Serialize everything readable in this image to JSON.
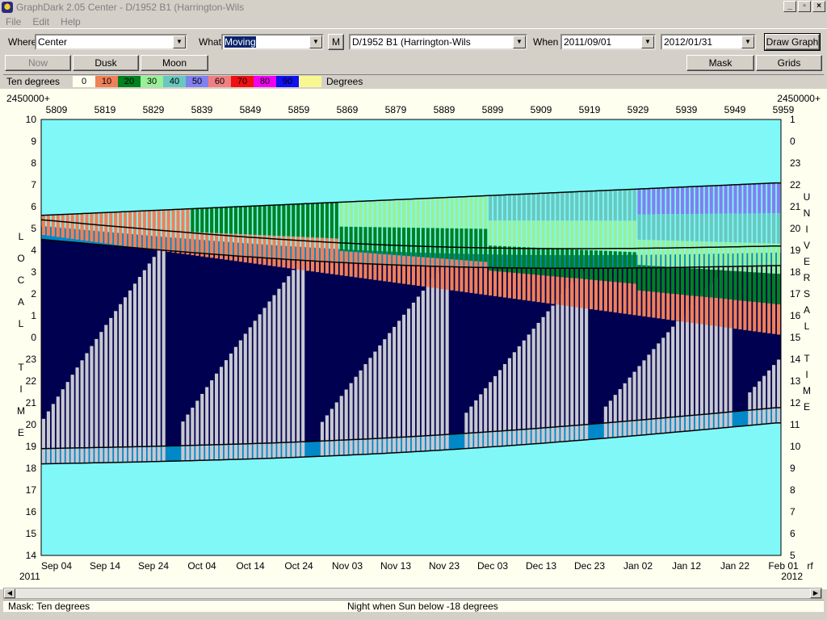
{
  "window": {
    "title": "GraphDark 2.05  Center  -  D/1952 B1 (Harrington-Wils",
    "buttons": [
      "_",
      "▫",
      "×"
    ]
  },
  "menu": [
    "File",
    "Edit",
    "Help"
  ],
  "toolbar": {
    "where_label": "Where",
    "where_value": "Center",
    "what_label": "What",
    "what_value": "Moving",
    "m_button": "M",
    "object_value": "D/1952 B1 (Harrington-Wils",
    "when_label": "When",
    "date_from": "2011/09/01",
    "date_to": "2012/01/31",
    "draw_button": "Draw Graph"
  },
  "buttons_row": {
    "now": "Now",
    "dusk": "Dusk",
    "moon": "Moon",
    "mask": "Mask",
    "grids": "Grids"
  },
  "legend": {
    "title": "Ten degrees",
    "units": "Degrees",
    "items": [
      {
        "label": "0",
        "color": "#fffff0"
      },
      {
        "label": "10",
        "color": "#f08058"
      },
      {
        "label": "20",
        "color": "#008020"
      },
      {
        "label": "30",
        "color": "#98f098"
      },
      {
        "label": "40",
        "color": "#68c8c0"
      },
      {
        "label": "50",
        "color": "#8080f0"
      },
      {
        "label": "60",
        "color": "#f08080"
      },
      {
        "label": "70",
        "color": "#f01010"
      },
      {
        "label": "80",
        "color": "#f000f0"
      },
      {
        "label": "90",
        "color": "#1010f0"
      },
      {
        "label": "",
        "color": "#f8f890"
      }
    ]
  },
  "chart_data": {
    "type": "heatmap",
    "top_axis_prefix_left": "2450000+",
    "top_axis_prefix_right": "2450000+",
    "top_ticks": [
      "5809",
      "5819",
      "5829",
      "5839",
      "5849",
      "5859",
      "5869",
      "5879",
      "5889",
      "5899",
      "5909",
      "5919",
      "5929",
      "5939",
      "5949",
      "5959"
    ],
    "bottom_ticks": [
      "Sep 04",
      "Sep 14",
      "Sep 24",
      "Oct 04",
      "Oct 14",
      "Oct 24",
      "Nov 03",
      "Nov 13",
      "Nov 23",
      "Dec 03",
      "Dec 13",
      "Dec 23",
      "Jan 02",
      "Jan 12",
      "Jan 22",
      "Feb 01"
    ],
    "bottom_year_left": "2011",
    "bottom_year_right": "2012",
    "bottom_right_label": "rf",
    "left_ticks": [
      "10",
      "9",
      "8",
      "7",
      "6",
      "5",
      "4",
      "3",
      "2",
      "1",
      "0",
      "23",
      "22",
      "21",
      "20",
      "19",
      "18",
      "17",
      "16",
      "15",
      "14"
    ],
    "right_ticks": [
      "1",
      "0",
      "23",
      "22",
      "21",
      "20",
      "19",
      "18",
      "17",
      "16",
      "15",
      "14",
      "13",
      "12",
      "11",
      "10",
      "9",
      "8",
      "7",
      "6",
      "5"
    ],
    "left_axis_label": [
      "L",
      "O",
      "C",
      "A",
      "L",
      "",
      "T",
      "I",
      "M",
      "E"
    ],
    "right_axis_label": [
      "U",
      "N",
      "I",
      "V",
      "E",
      "R",
      "S",
      "A",
      "L",
      "",
      "T",
      "I",
      "M",
      "E"
    ],
    "colors": {
      "twilight": "#80f8f8",
      "night": "#000050",
      "moon": "#c8c8d0",
      "dusk_band": "#0088c8",
      "altitude_10": "#f08058",
      "altitude_20": "#008020",
      "altitude_30": "#98f098",
      "altitude_40": "#68c8c0",
      "altitude_50": "#8080f0"
    }
  },
  "status": {
    "mask": "Mask:  Ten degrees",
    "night_rule": "Night when Sun below -18 degrees"
  }
}
